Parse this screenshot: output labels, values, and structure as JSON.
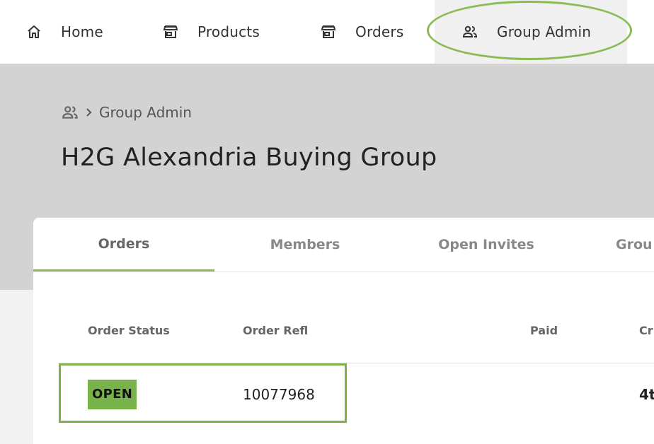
{
  "nav": {
    "home": {
      "label": "Home",
      "icon": "home-icon"
    },
    "products": {
      "label": "Products",
      "icon": "store-icon"
    },
    "orders": {
      "label": "Orders",
      "icon": "store-icon"
    },
    "group_admin": {
      "label": "Group Admin",
      "icon": "people-icon",
      "active": true
    }
  },
  "breadcrumb": {
    "icon": "people-icon",
    "label": "Group Admin"
  },
  "page": {
    "title": "H2G Alexandria Buying Group"
  },
  "tabs": [
    {
      "label": "Orders",
      "active": true
    },
    {
      "label": "Members"
    },
    {
      "label": "Open Invites"
    },
    {
      "label": "Grou"
    }
  ],
  "table": {
    "headers": {
      "status": "Order Status",
      "ref": "Order Refl",
      "paid": "Paid",
      "created": "Cr"
    },
    "rows": [
      {
        "status": "OPEN",
        "ref": "10077968",
        "paid": "",
        "created": "4t"
      }
    ]
  },
  "colors": {
    "accent": "#8bbb54",
    "badge": "#77b34a",
    "header_band": "#d3d3d3"
  }
}
